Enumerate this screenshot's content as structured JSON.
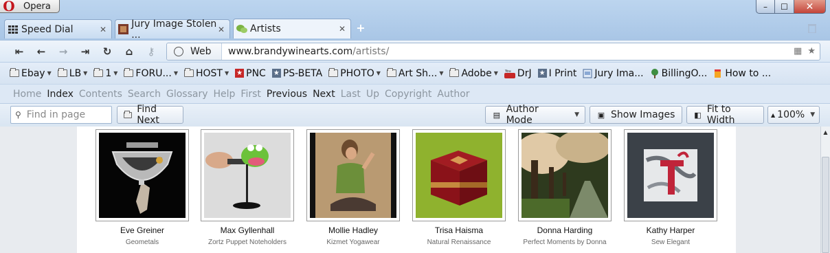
{
  "window": {
    "menu_label": "Opera",
    "controls": [
      "–",
      "☐",
      "✕"
    ]
  },
  "tabs": [
    {
      "label": "Speed Dial",
      "icon": "grid-icon",
      "active": false
    },
    {
      "label": "Jury Image Stolen ...",
      "icon": "site-icon",
      "active": false
    },
    {
      "label": "Artists",
      "icon": "leaf-icon",
      "active": true
    }
  ],
  "nav": {
    "address_badge": "Web",
    "url_host": "www.brandywinearts.com",
    "url_path": "/artists/"
  },
  "bookmarks": [
    {
      "label": "Ebay",
      "type": "folder",
      "menu": true
    },
    {
      "label": "LB",
      "type": "folder",
      "menu": true
    },
    {
      "label": "1",
      "type": "folder",
      "menu": true
    },
    {
      "label": "FORU...",
      "type": "folder",
      "menu": true
    },
    {
      "label": "HOST",
      "type": "folder",
      "menu": true
    },
    {
      "label": "PNC",
      "type": "star",
      "menu": false
    },
    {
      "label": "PS-BETA",
      "type": "star",
      "menu": false
    },
    {
      "label": "PHOTO",
      "type": "folder",
      "menu": true
    },
    {
      "label": "Art Sh...",
      "type": "folder",
      "menu": true
    },
    {
      "label": "Adobe",
      "type": "folder",
      "menu": true
    },
    {
      "label": "DrJ",
      "type": "youtube",
      "menu": false
    },
    {
      "label": "I Print",
      "type": "star",
      "menu": false
    },
    {
      "label": "Jury Ima...",
      "type": "page",
      "menu": false
    },
    {
      "label": "BillingO...",
      "type": "tree",
      "menu": false
    },
    {
      "label": "How to ...",
      "type": "page",
      "menu": false
    }
  ],
  "linkbar": [
    {
      "label": "Home",
      "enabled": false
    },
    {
      "label": "Index",
      "enabled": true
    },
    {
      "label": "Contents",
      "enabled": false
    },
    {
      "label": "Search",
      "enabled": false
    },
    {
      "label": "Glossary",
      "enabled": false
    },
    {
      "label": "Help",
      "enabled": false
    },
    {
      "label": "First",
      "enabled": false
    },
    {
      "label": "Previous",
      "enabled": true
    },
    {
      "label": "Next",
      "enabled": true
    },
    {
      "label": "Last",
      "enabled": false
    },
    {
      "label": "Up",
      "enabled": false
    },
    {
      "label": "Copyright",
      "enabled": false
    },
    {
      "label": "Author",
      "enabled": false
    }
  ],
  "findbar": {
    "placeholder": "Find in page",
    "find_next": "Find Next",
    "author_mode": "Author Mode",
    "show_images": "Show Images",
    "fit_to_width": "Fit to Width",
    "zoom": "100%"
  },
  "artists": [
    {
      "name": "Eve Greiner",
      "business": "Geometals"
    },
    {
      "name": "Max Gyllenhall",
      "business": "Zortz Puppet Noteholders"
    },
    {
      "name": "Mollie Hadley",
      "business": "Kizmet Yogawear"
    },
    {
      "name": "Trisa Haisma",
      "business": "Natural Renaissance"
    },
    {
      "name": "Donna Harding",
      "business": "Perfect Moments by Donna"
    },
    {
      "name": "Kathy Harper",
      "business": "Sew Elegant"
    }
  ]
}
